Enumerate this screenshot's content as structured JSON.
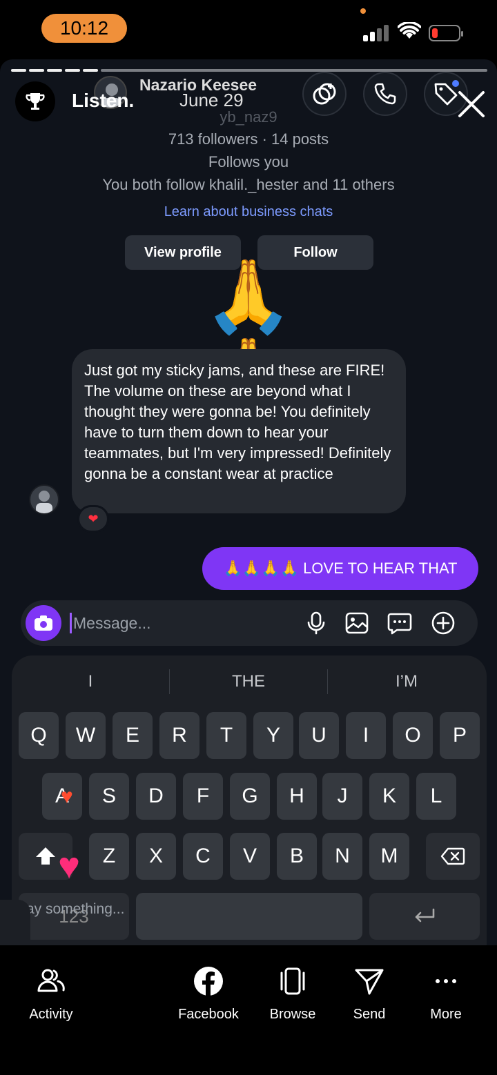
{
  "status_bar": {
    "time": "10:12"
  },
  "story": {
    "title": "Listen.",
    "subtitle": "June 29"
  },
  "dm_header": {
    "name": "Nazario Keesee",
    "handle": "yb_naz9"
  },
  "profile": {
    "followers_posts": "713 followers · 14 posts",
    "follows_you": "Follows you",
    "mutuals": "You both follow khalil._hester and 11 others",
    "business_link": "Learn about business chats",
    "view_profile": "View profile",
    "follow": "Follow"
  },
  "conversation": {
    "emoji_message": "🙏🙏",
    "incoming_message": "Just got my sticky jams, and these are FIRE! The volume on these are beyond what I thought they were gonna be! You definitely have to turn them down to hear your teammates, but I'm very impressed! Definitely gonna be a constant wear at practice",
    "reaction": "❤",
    "outgoing_message": "🙏🙏🙏🙏 LOVE TO HEAR THAT"
  },
  "composer": {
    "placeholder": "Message..."
  },
  "keyboard": {
    "suggestions": [
      "I",
      "THE",
      "I’M"
    ],
    "row1": [
      "Q",
      "W",
      "E",
      "R",
      "T",
      "Y",
      "U",
      "I",
      "O",
      "P"
    ],
    "row2": [
      "A",
      "S",
      "D",
      "F",
      "G",
      "H",
      "J",
      "K",
      "L"
    ],
    "row3": [
      "Z",
      "X",
      "C",
      "V",
      "B",
      "N",
      "M"
    ],
    "numbers_key": "123",
    "ghost_prompt": "ay something..."
  },
  "bottom_nav": {
    "items": [
      "Activity",
      "Facebook",
      "Browse",
      "Send",
      "More"
    ]
  },
  "colors": {
    "accent_purple": "#7f36f5",
    "status_orange": "#f0903a",
    "link_blue": "#7d9bff",
    "battery_red": "#ff3b30"
  }
}
